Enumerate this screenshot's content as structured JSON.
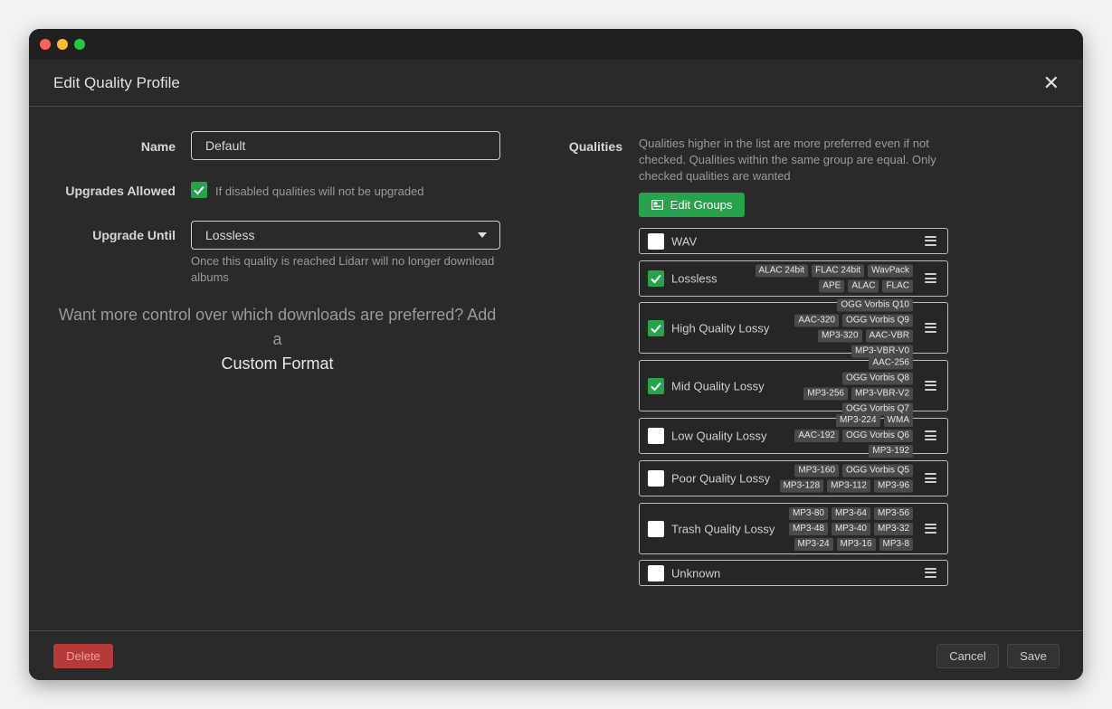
{
  "modal": {
    "title": "Edit Quality Profile"
  },
  "form": {
    "name_label": "Name",
    "name_value": "Default",
    "upgrades_label": "Upgrades Allowed",
    "upgrades_help": "If disabled qualities will not be upgraded",
    "upgrades_checked": true,
    "upgrade_until_label": "Upgrade Until",
    "upgrade_until_value": "Lossless",
    "upgrade_until_help": "Once this quality is reached Lidarr will no longer download albums"
  },
  "promo": {
    "text": "Want more control over which downloads are preferred? Add a",
    "link": "Custom Format"
  },
  "qualities": {
    "label": "Qualities",
    "help": "Qualities higher in the list are more preferred even if not checked. Qualities within the same group are equal. Only checked qualities are wanted",
    "edit_groups_label": "Edit Groups",
    "items": [
      {
        "name": "WAV",
        "checked": false,
        "tags": []
      },
      {
        "name": "Lossless",
        "checked": true,
        "tags": [
          "ALAC 24bit",
          "FLAC 24bit",
          "WavPack",
          "APE",
          "ALAC",
          "FLAC"
        ]
      },
      {
        "name": "High Quality Lossy",
        "checked": true,
        "tags": [
          "OGG Vorbis Q10",
          "AAC-320",
          "OGG Vorbis Q9",
          "MP3-320",
          "AAC-VBR",
          "MP3-VBR-V0"
        ]
      },
      {
        "name": "Mid Quality Lossy",
        "checked": true,
        "tags": [
          "AAC-256",
          "OGG Vorbis Q8",
          "MP3-256",
          "MP3-VBR-V2",
          "OGG Vorbis Q7"
        ]
      },
      {
        "name": "Low Quality Lossy",
        "checked": false,
        "tags": [
          "MP3-224",
          "WMA",
          "AAC-192",
          "OGG Vorbis Q6",
          "MP3-192"
        ]
      },
      {
        "name": "Poor Quality Lossy",
        "checked": false,
        "tags": [
          "MP3-160",
          "OGG Vorbis Q5",
          "MP3-128",
          "MP3-112",
          "MP3-96"
        ]
      },
      {
        "name": "Trash Quality Lossy",
        "checked": false,
        "tags": [
          "MP3-80",
          "MP3-64",
          "MP3-56",
          "MP3-48",
          "MP3-40",
          "MP3-32",
          "MP3-24",
          "MP3-16",
          "MP3-8"
        ]
      },
      {
        "name": "Unknown",
        "checked": false,
        "tags": []
      }
    ]
  },
  "footer": {
    "delete_label": "Delete",
    "cancel_label": "Cancel",
    "save_label": "Save"
  },
  "colors": {
    "accent_green": "#27a34d",
    "danger_red": "#b53a3a",
    "panel_bg": "#2a2a2a"
  }
}
